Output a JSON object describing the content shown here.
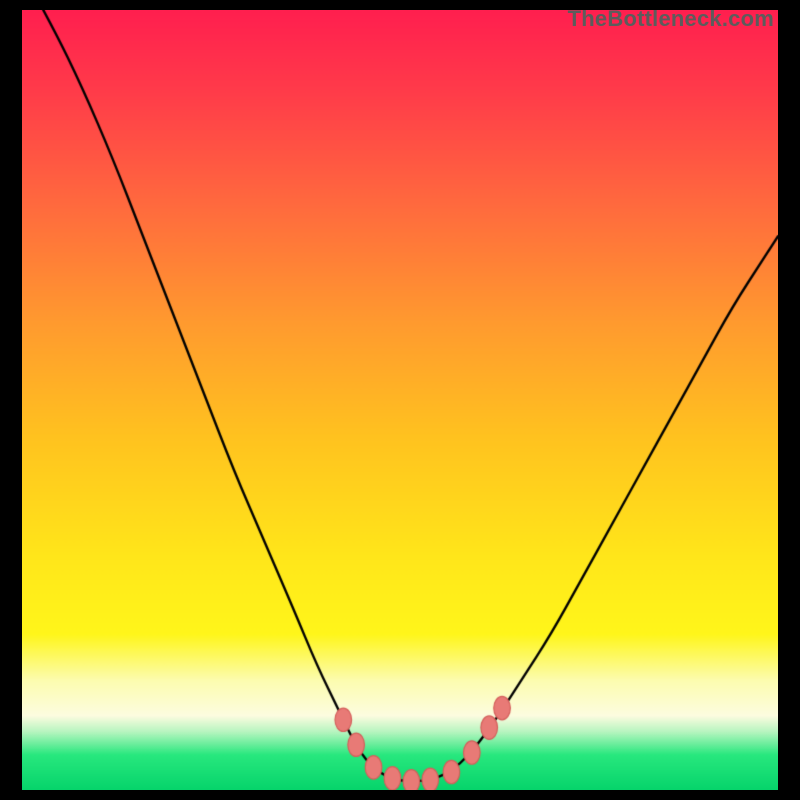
{
  "watermark": "TheBottleneck.com",
  "colors": {
    "black": "#000000",
    "curve": "#000000",
    "marker_fill": "#e87a76",
    "marker_stroke": "#d45f5b"
  },
  "gradient_stops": [
    {
      "t": 0.0,
      "color": "#ff1f4f"
    },
    {
      "t": 0.1,
      "color": "#ff3a4a"
    },
    {
      "t": 0.25,
      "color": "#ff6a3e"
    },
    {
      "t": 0.4,
      "color": "#ff9a2f"
    },
    {
      "t": 0.55,
      "color": "#ffc31f"
    },
    {
      "t": 0.7,
      "color": "#ffe61a"
    },
    {
      "t": 0.8,
      "color": "#fff61a"
    },
    {
      "t": 0.86,
      "color": "#fcfcb0"
    },
    {
      "t": 0.905,
      "color": "#fcfce0"
    },
    {
      "t": 0.925,
      "color": "#b8f5c0"
    },
    {
      "t": 0.955,
      "color": "#28e87e"
    },
    {
      "t": 1.0,
      "color": "#06d46b"
    }
  ],
  "chart_data": {
    "type": "line",
    "title": "",
    "xlabel": "",
    "ylabel": "",
    "xlim": [
      0,
      100
    ],
    "ylim": [
      0,
      100
    ],
    "curve": [
      {
        "x": 0,
        "y": 105
      },
      {
        "x": 4,
        "y": 98
      },
      {
        "x": 8,
        "y": 90
      },
      {
        "x": 12,
        "y": 81
      },
      {
        "x": 16,
        "y": 71
      },
      {
        "x": 20,
        "y": 61
      },
      {
        "x": 24,
        "y": 51
      },
      {
        "x": 28,
        "y": 41
      },
      {
        "x": 32,
        "y": 32
      },
      {
        "x": 36,
        "y": 23
      },
      {
        "x": 39,
        "y": 16
      },
      {
        "x": 42,
        "y": 10
      },
      {
        "x": 44,
        "y": 6
      },
      {
        "x": 46,
        "y": 3.2
      },
      {
        "x": 48,
        "y": 1.8
      },
      {
        "x": 50,
        "y": 1.2
      },
      {
        "x": 52,
        "y": 1.1
      },
      {
        "x": 54,
        "y": 1.3
      },
      {
        "x": 56,
        "y": 2.0
      },
      {
        "x": 58,
        "y": 3.4
      },
      {
        "x": 60,
        "y": 5.5
      },
      {
        "x": 63,
        "y": 9.5
      },
      {
        "x": 66,
        "y": 14
      },
      {
        "x": 70,
        "y": 20
      },
      {
        "x": 74,
        "y": 27
      },
      {
        "x": 78,
        "y": 34
      },
      {
        "x": 82,
        "y": 41
      },
      {
        "x": 86,
        "y": 48
      },
      {
        "x": 90,
        "y": 55
      },
      {
        "x": 94,
        "y": 62
      },
      {
        "x": 98,
        "y": 68
      },
      {
        "x": 100,
        "y": 71
      }
    ],
    "markers": [
      {
        "x": 42.5,
        "y": 9.0
      },
      {
        "x": 44.2,
        "y": 5.8
      },
      {
        "x": 46.5,
        "y": 2.9
      },
      {
        "x": 49.0,
        "y": 1.5
      },
      {
        "x": 51.5,
        "y": 1.1
      },
      {
        "x": 54.0,
        "y": 1.3
      },
      {
        "x": 56.8,
        "y": 2.3
      },
      {
        "x": 59.5,
        "y": 4.8
      },
      {
        "x": 61.8,
        "y": 8.0
      },
      {
        "x": 63.5,
        "y": 10.5
      }
    ],
    "marker_radius_x": 1.1,
    "marker_radius_y": 1.5
  }
}
